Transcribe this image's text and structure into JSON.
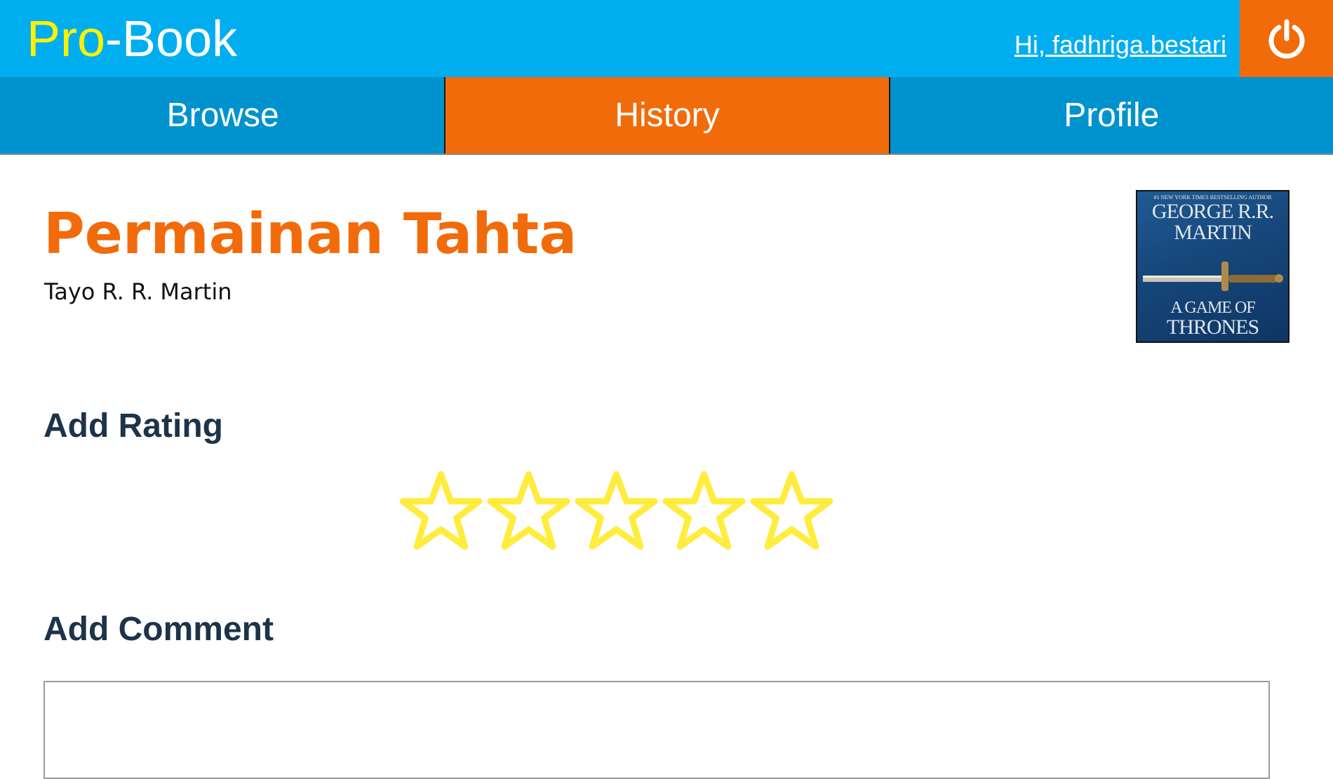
{
  "header": {
    "logo_accent": "Pro",
    "logo_rest": "-Book",
    "greeting": "Hi, fadhriga.bestari",
    "logout_icon": "power-icon"
  },
  "nav": {
    "tabs": [
      {
        "label": "Browse",
        "active": false
      },
      {
        "label": "History",
        "active": true
      },
      {
        "label": "Profile",
        "active": false
      }
    ]
  },
  "book": {
    "title": "Permainan Tahta",
    "author": "Tayo R. R. Martin",
    "cover": {
      "tagline": "#1 NEW YORK TIMES BESTSELLING AUTHOR",
      "author": "GEORGE R.R. MARTIN",
      "title_line1": "A GAME OF",
      "title_line2": "THRONES"
    }
  },
  "rating": {
    "heading": "Add Rating",
    "max_stars": 5,
    "value": 0,
    "star_color": "#ffec3d"
  },
  "comment": {
    "heading": "Add Comment",
    "value": ""
  },
  "colors": {
    "header_bg": "#00aeef",
    "nav_bg": "#0092cf",
    "accent_orange": "#f26b0a",
    "logo_yellow": "#fff200",
    "heading_navy": "#1d3349"
  }
}
